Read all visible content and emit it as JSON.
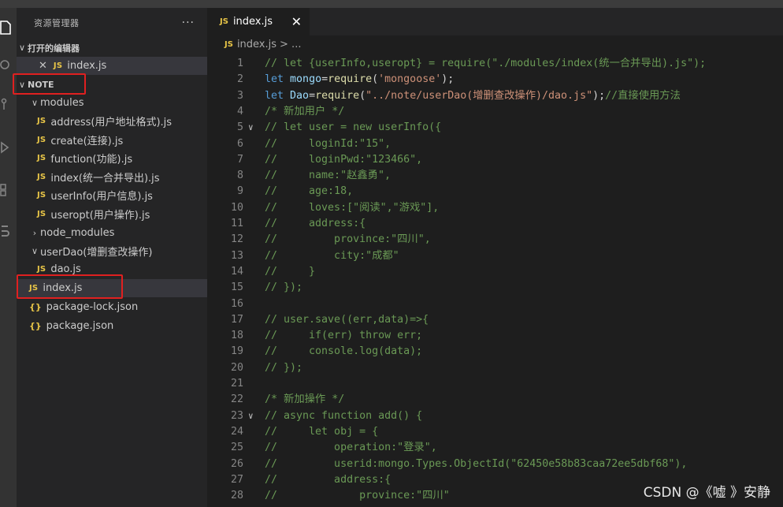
{
  "sidebar": {
    "title": "资源管理器",
    "more": "···",
    "open_editors_label": "打开的编辑器",
    "open_editor_file": "index.js",
    "root": "NOTE",
    "items": [
      {
        "label": "modules",
        "kind": "folder",
        "expanded": true
      },
      {
        "label": "address(用户地址格式).js",
        "kind": "js"
      },
      {
        "label": "create(连接).js",
        "kind": "js"
      },
      {
        "label": "function(功能).js",
        "kind": "js"
      },
      {
        "label": "index(统一合并导出).js",
        "kind": "js"
      },
      {
        "label": "userInfo(用户信息).js",
        "kind": "js"
      },
      {
        "label": "useropt(用户操作).js",
        "kind": "js"
      },
      {
        "label": "node_modules",
        "kind": "folder",
        "expanded": false
      },
      {
        "label": "userDao(增删查改操作)",
        "kind": "folder",
        "expanded": true
      },
      {
        "label": "dao.js",
        "kind": "js"
      },
      {
        "label": "index.js",
        "kind": "js",
        "selected": true
      },
      {
        "label": "package-lock.json",
        "kind": "json"
      },
      {
        "label": "package.json",
        "kind": "json"
      }
    ]
  },
  "editor": {
    "tab_label": "index.js",
    "close_glyph": "✕",
    "breadcrumb_file": "index.js",
    "breadcrumb_rest": "> ...",
    "line_numbers": [
      "1",
      "2",
      "3",
      "4",
      "5",
      "6",
      "7",
      "8",
      "9",
      "10",
      "11",
      "12",
      "13",
      "14",
      "15",
      "16",
      "17",
      "18",
      "19",
      "20",
      "21",
      "22",
      "23",
      "24",
      "25",
      "26",
      "27",
      "28"
    ]
  },
  "watermark": "CSDN @《嘘 》安静",
  "colors": {
    "accent_highlight": "#e02020",
    "js_icon": "#e8c547",
    "comment": "#6a9955",
    "keyword": "#569cd6"
  }
}
